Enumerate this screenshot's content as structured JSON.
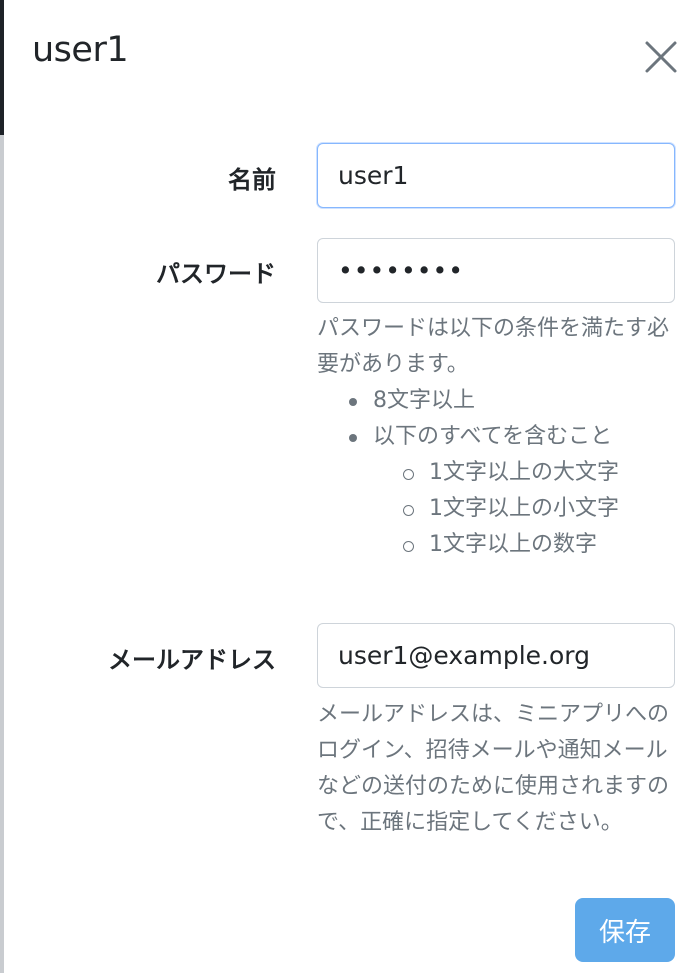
{
  "modal": {
    "title": "user1"
  },
  "form": {
    "name": {
      "label": "名前",
      "value": "user1"
    },
    "password": {
      "label": "パスワード",
      "value": "••••••••",
      "help_intro": "パスワードは以下の条件を満たす必要があります。",
      "rules": [
        "8文字以上",
        "以下のすべてを含むこと"
      ],
      "sub_rules": [
        "1文字以上の大文字",
        "1文字以上の小文字",
        "1文字以上の数字"
      ]
    },
    "email": {
      "label": "メールアドレス",
      "value": "user1@example.org",
      "help": "メールアドレスは、ミニアプリへのログイン、招待メールや通知メールなどの送付のために使用されますので、正確に指定してください。"
    }
  },
  "footer": {
    "save_label": "保存"
  },
  "colors": {
    "primary_button": "#5ea9ea",
    "help_text": "#6c757d",
    "focus_border": "#86b7fe"
  }
}
